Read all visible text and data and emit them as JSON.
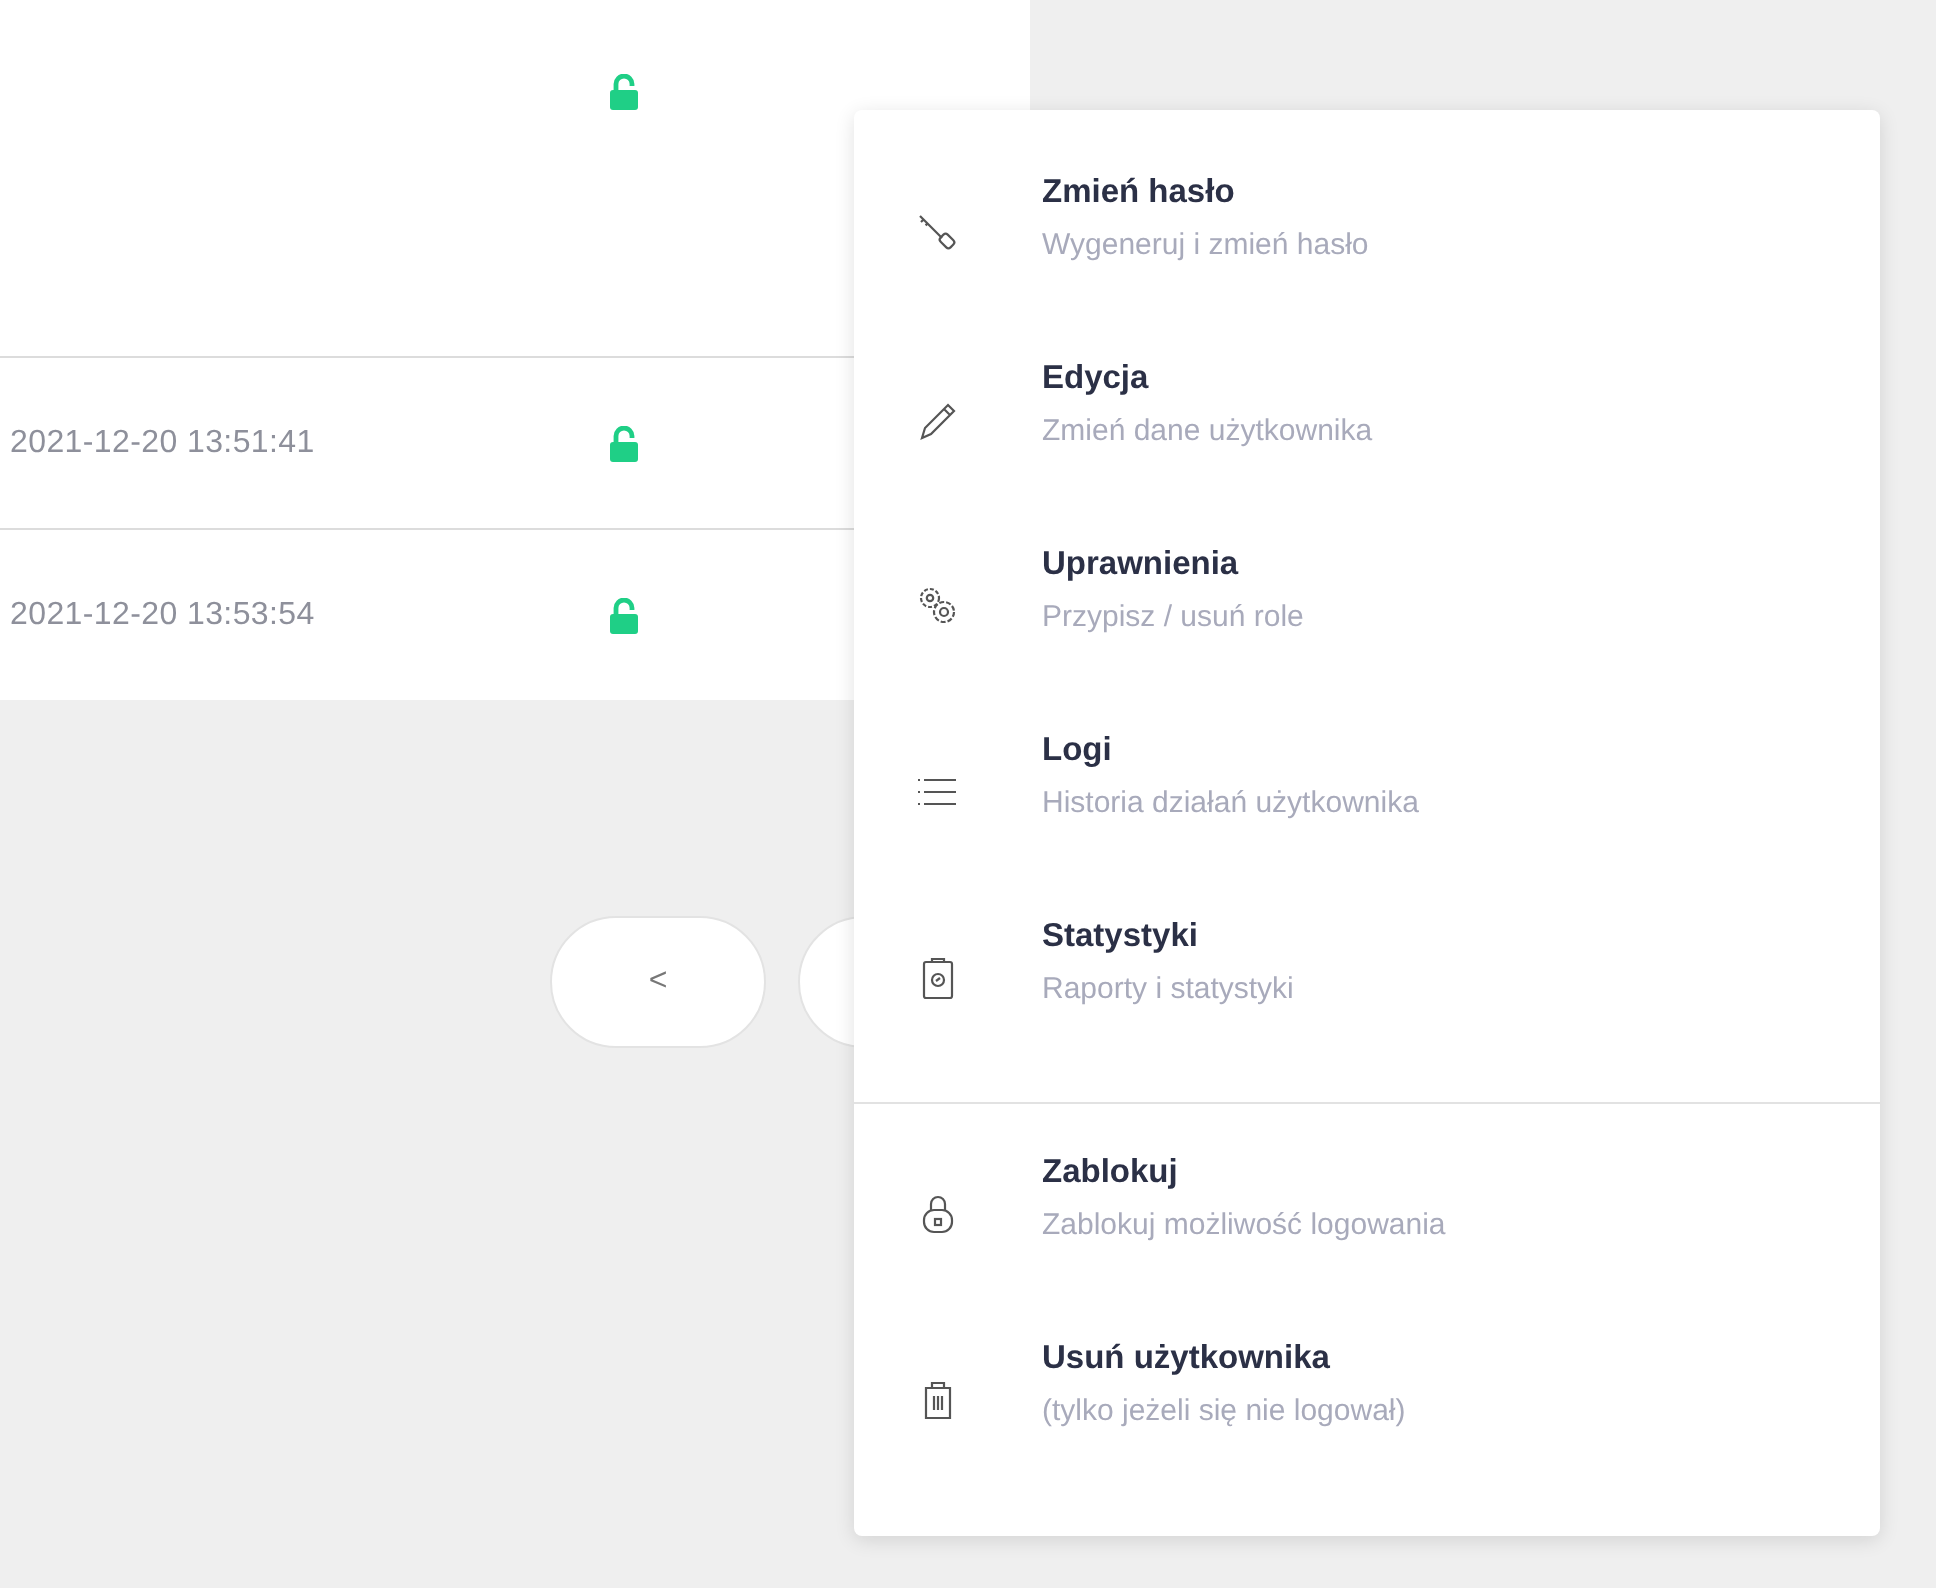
{
  "table": {
    "rows": [
      {
        "locked": false
      },
      {
        "last_login": "2021-12-20 13:51:41",
        "locked": false
      },
      {
        "last_login": "2021-12-20 13:53:54",
        "locked": false
      }
    ]
  },
  "pagination": {
    "previous": "<"
  },
  "menu": {
    "sections": [
      {
        "items": [
          {
            "title": "Zmień hasło",
            "subtitle": "Wygeneruj i zmień hasło"
          },
          {
            "title": "Edycja",
            "subtitle": "Zmień dane użytkownika"
          },
          {
            "title": "Uprawnienia",
            "subtitle": "Przypisz / usuń role"
          },
          {
            "title": "Logi",
            "subtitle": "Historia działań użytkownika"
          },
          {
            "title": "Statystyki",
            "subtitle": "Raporty i statystyki"
          }
        ]
      },
      {
        "items": [
          {
            "title": "Zablokuj",
            "subtitle": "Zablokuj możliwość logowania"
          },
          {
            "title": "Usuń użytkownika",
            "subtitle": "(tylko jeżeli się nie logował)"
          }
        ]
      }
    ]
  }
}
